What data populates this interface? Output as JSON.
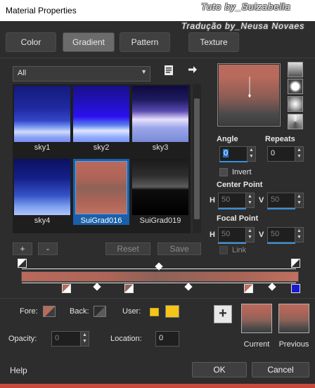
{
  "window": {
    "title": "Material Properties"
  },
  "watermark": {
    "line1": "Tuto by_Suizabella",
    "line2": "Tradução by_Neusa Novaes"
  },
  "tabs": [
    {
      "label": "Color",
      "active": false
    },
    {
      "label": "Gradient",
      "active": true
    },
    {
      "label": "Pattern",
      "active": false
    },
    {
      "label": "Texture",
      "active": false
    }
  ],
  "category": {
    "selected": "All"
  },
  "gradients": [
    {
      "name": "sky1",
      "selected": false
    },
    {
      "name": "sky2",
      "selected": false
    },
    {
      "name": "sky3",
      "selected": false
    },
    {
      "name": "sky4",
      "selected": false
    },
    {
      "name": "SuiGrad016",
      "selected": true
    },
    {
      "name": "SuiGrad019",
      "selected": false
    }
  ],
  "list_buttons": {
    "add": "+",
    "remove": "-",
    "reset": "Reset",
    "save": "Save"
  },
  "angle": {
    "label": "Angle",
    "value": "0"
  },
  "repeats": {
    "label": "Repeats",
    "value": "0"
  },
  "invert": {
    "label": "Invert",
    "checked": false
  },
  "center_point": {
    "label": "Center Point",
    "h_label": "H",
    "h_value": "50",
    "v_label": "V",
    "v_value": "50"
  },
  "focal_point": {
    "label": "Focal Point",
    "h_label": "H",
    "h_value": "50",
    "v_label": "V",
    "v_value": "50"
  },
  "link": {
    "label": "Link",
    "checked": false
  },
  "colors": {
    "gradient_start": "#b86a5c",
    "gradient_mid": "#8e6258",
    "gradient_end": "#c0705f",
    "fore": "#b86a5c",
    "back": "#3d3d3d",
    "user_swatch": "#f5c518",
    "accent": "#3b8fe0"
  },
  "stops": {
    "fore_label": "Fore:",
    "back_label": "Back:",
    "user_label": "User:",
    "opacity_label": "Opacity:",
    "opacity_value": "0",
    "location_label": "Location:",
    "location_value": "0"
  },
  "add_button": "+",
  "current_label": "Current",
  "previous_label": "Previous",
  "footer": {
    "help": "Help",
    "ok": "OK",
    "cancel": "Cancel"
  }
}
